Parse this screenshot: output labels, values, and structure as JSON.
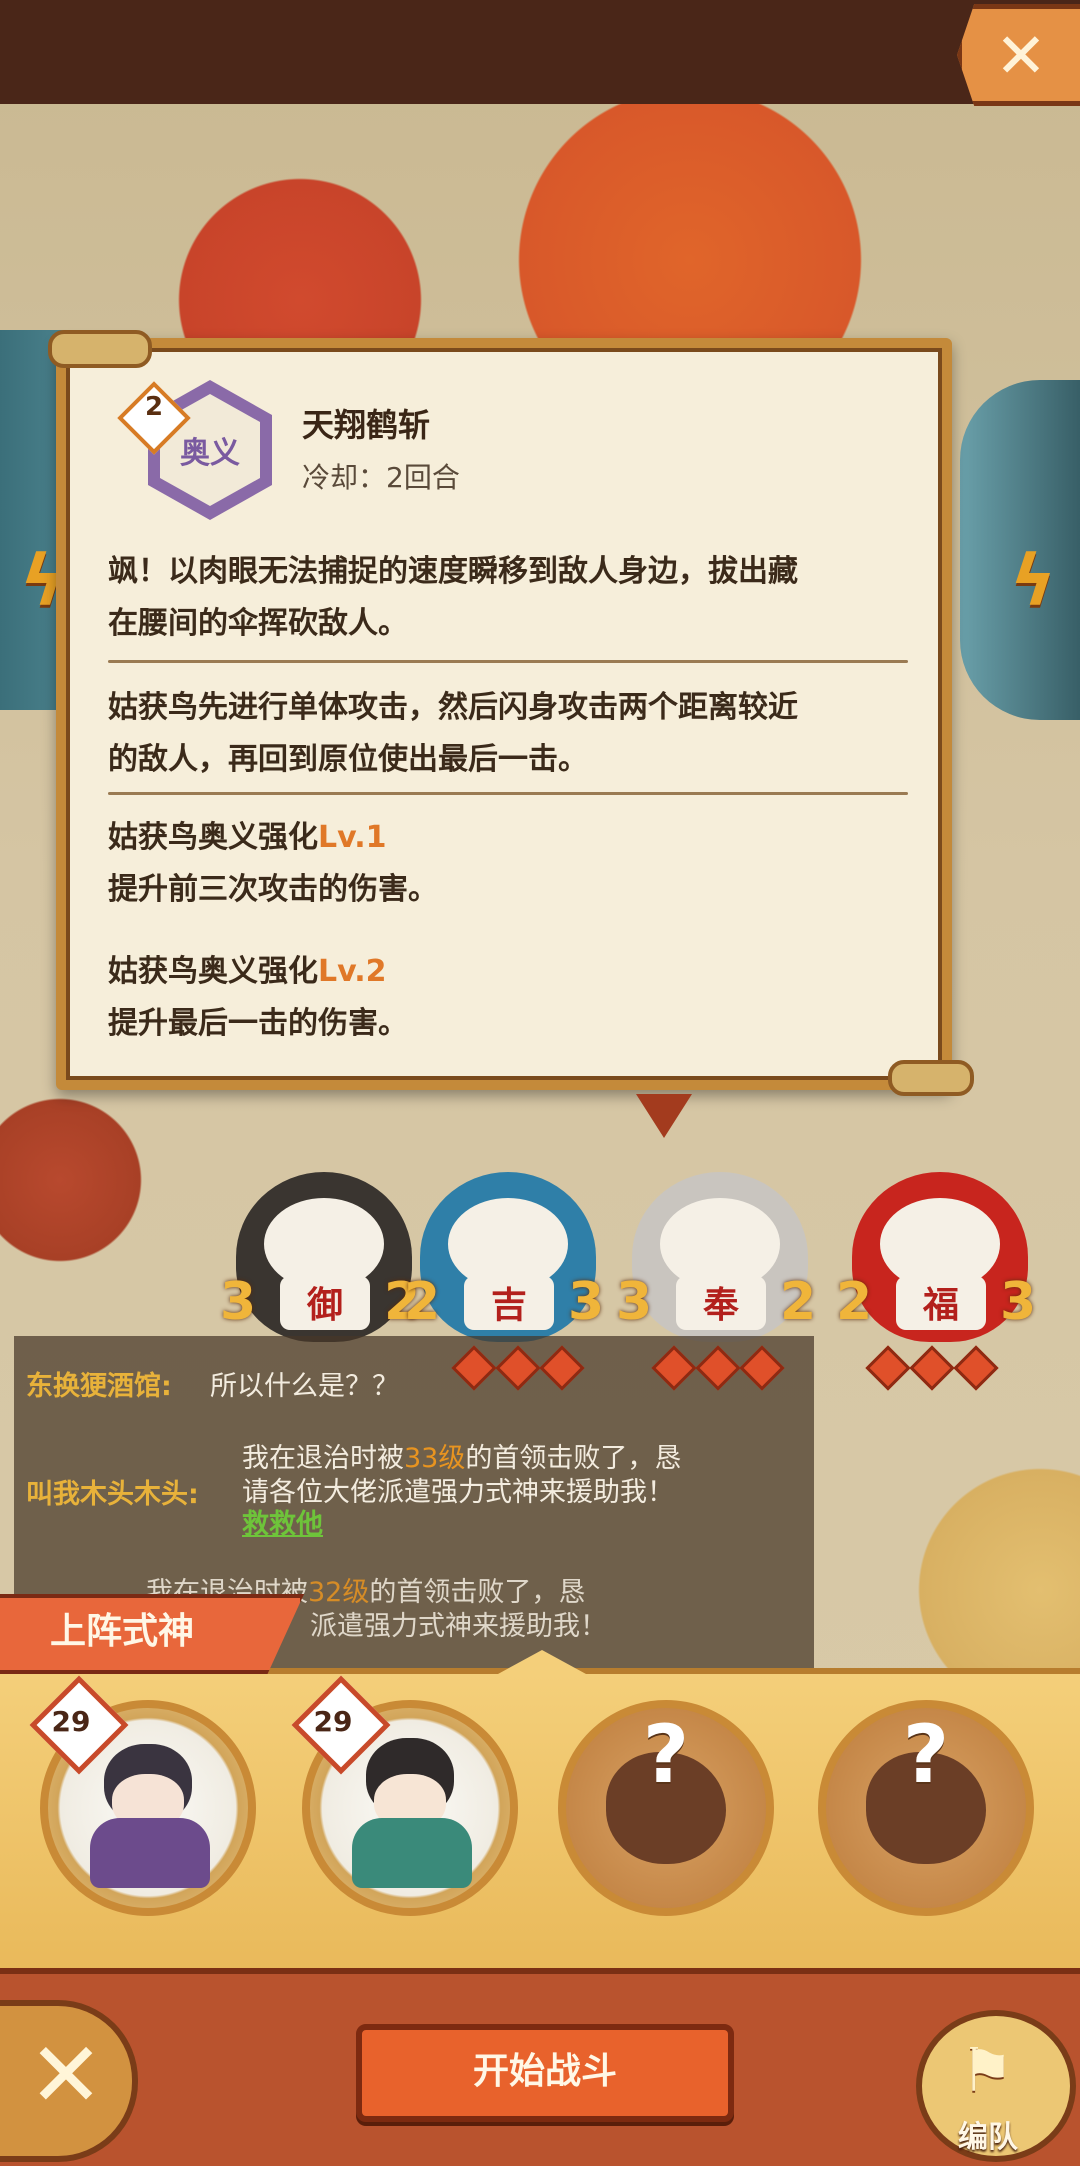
{
  "header": {
    "close_label": "✕"
  },
  "skill": {
    "badge_level": "2",
    "icon_text": "奥义",
    "name": "天翔鹤斩",
    "cooldown": "冷却：2回合",
    "desc1_line1": "飒！以肉眼无法捕捉的速度瞬移到敌人身边，拔出藏",
    "desc1_line2": "在腰间的伞挥砍敌人。",
    "desc2_line1": "姑获鸟先进行单体攻击，然后闪身攻击两个距离较近",
    "desc2_line2": "的敌人，再回到原位使出最后一击。",
    "upgrades": [
      {
        "title": "姑获鸟奥义强化",
        "level": "Lv.1",
        "effect": "提升前三次攻击的伤害。"
      },
      {
        "title": "姑获鸟奥义强化",
        "level": "Lv.2",
        "effect": "提升最后一击的伤害。"
      }
    ]
  },
  "darumas": [
    {
      "label": "御",
      "color": "#3a3530",
      "left_num": "3",
      "right_num": "2"
    },
    {
      "label": "吉",
      "color": "#2f7fa8",
      "left_num": "2",
      "right_num": "3"
    },
    {
      "label": "奉",
      "color": "#c9c5bf",
      "left_num": "3",
      "right_num": "2"
    },
    {
      "label": "福",
      "color": "#c8251e",
      "left_num": "2",
      "right_num": "3"
    }
  ],
  "chat": {
    "msg1_name": "东换㹴酒馆:",
    "msg1_text": "所以什么是？？",
    "msg2_name": "叫我木头木头:",
    "msg2_line1_a": "我在退治时被",
    "msg2_line1_hl": "33级",
    "msg2_line1_b": "的首领击败了，恳",
    "msg2_line2": "请各位大佬派遣强力式神来援助我！",
    "msg2_link": "救救他",
    "msg3_line1_a": "我在退治时被",
    "msg3_line1_hl": "32级",
    "msg3_line1_b": "的首领击败了，恳",
    "msg3_line2": "派遣强力式神来援助我！"
  },
  "lineup": {
    "tab_label": "上阵式神",
    "slots": [
      {
        "level": "29",
        "filled": true
      },
      {
        "level": "29",
        "filled": true
      },
      {
        "filled": false,
        "placeholder": "?"
      },
      {
        "filled": false,
        "placeholder": "?"
      }
    ]
  },
  "footer": {
    "cancel_label": "✕",
    "start_label": "开始战斗",
    "team_icon": "⚑",
    "team_label": "编队"
  },
  "colors": {
    "accent": "#e8622c",
    "panel_border": "#c48a3a",
    "level_text": "#e07828"
  }
}
